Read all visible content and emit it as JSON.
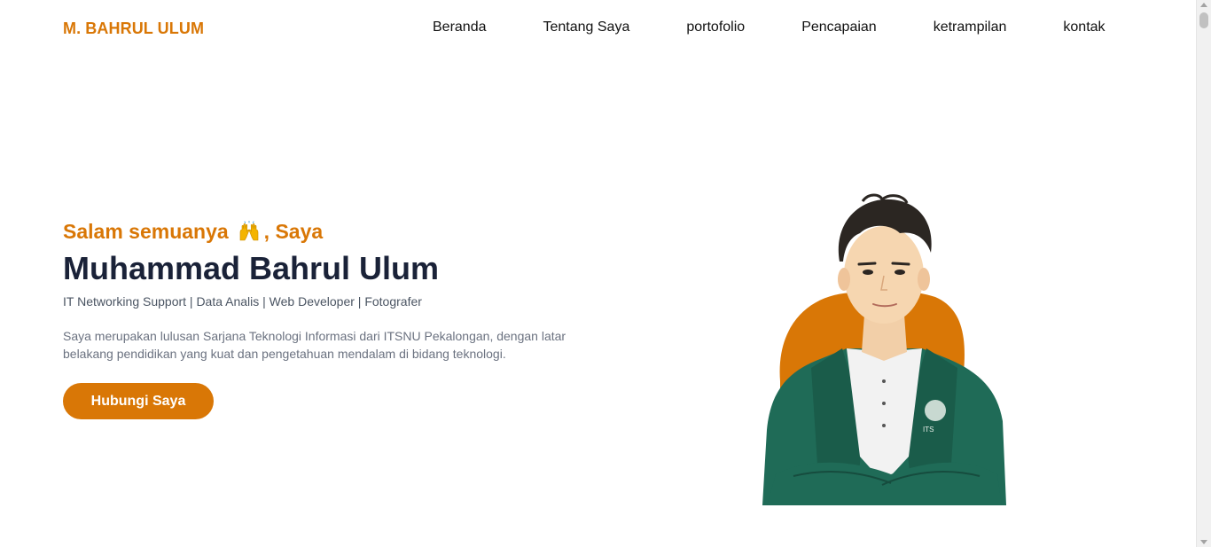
{
  "brand": {
    "logo_text": "M. BAHRUL ULUM",
    "accent_color": "#d97706",
    "heading_color": "#1a2238"
  },
  "nav": {
    "items": [
      {
        "label": "Beranda"
      },
      {
        "label": "Tentang Saya"
      },
      {
        "label": "portofolio"
      },
      {
        "label": "Pencapaian"
      },
      {
        "label": "ketrampilan"
      },
      {
        "label": "kontak"
      }
    ]
  },
  "hero": {
    "greeting_prefix": "Salam semuanya",
    "greeting_icon": "raising-hands-icon",
    "greeting_suffix": ", Saya",
    "name": "Muhammad Bahrul Ulum",
    "roles": "IT Networking Support | Data Analis | Web Developer | Fotografer",
    "bio": "Saya merupakan lulusan Sarjana Teknologi Informasi dari ITSNU Pekalongan, dengan latar belakang pendidikan yang kuat dan pengetahuan mendalam di bidang teknologi.",
    "cta_label": "Hubungi Saya",
    "photo_subject": "portrait-photo",
    "jacket_badge_text": "ITS"
  }
}
